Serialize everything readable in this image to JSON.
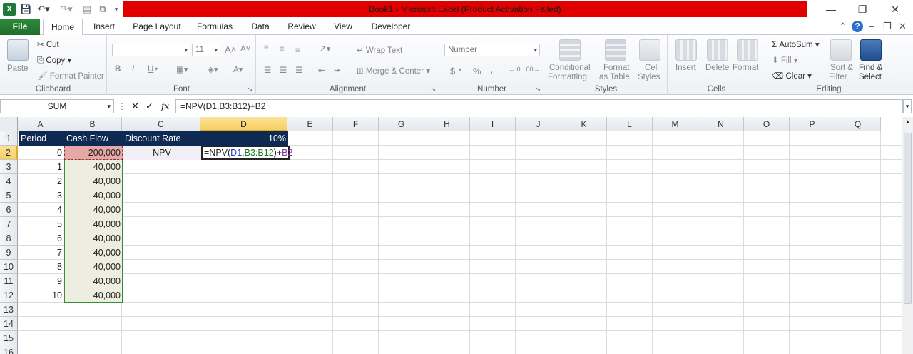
{
  "window": {
    "title": "Book1  -  Microsoft Excel (Product Activation Failed)",
    "controls": {
      "minimize": "—",
      "restore": "❐",
      "close": "✕"
    }
  },
  "ribbon_tabs": [
    "File",
    "Home",
    "Insert",
    "Page Layout",
    "Formulas",
    "Data",
    "Review",
    "View",
    "Developer"
  ],
  "active_tab": "Home",
  "ribbon": {
    "clipboard": {
      "label": "Clipboard",
      "paste": "Paste",
      "cut": "Cut",
      "copy": "Copy",
      "format_painter": "Format Painter"
    },
    "font": {
      "label": "Font",
      "font_name": "",
      "font_size": "11",
      "bold": "B",
      "italic": "I",
      "underline": "U"
    },
    "alignment": {
      "label": "Alignment",
      "wrap_text": "Wrap Text",
      "merge_center": "Merge & Center"
    },
    "number": {
      "label": "Number",
      "format": "Number",
      "currency": "$",
      "percent": "%",
      "comma": ","
    },
    "styles": {
      "label": "Styles",
      "conditional": "Conditional",
      "conditional2": "Formatting",
      "format_table": "Format",
      "format_table2": "as Table",
      "cell_styles": "Cell",
      "cell_styles2": "Styles"
    },
    "cells": {
      "label": "Cells",
      "insert": "Insert",
      "delete": "Delete",
      "format": "Format"
    },
    "editing": {
      "label": "Editing",
      "autosum": "AutoSum",
      "fill": "Fill",
      "clear": "Clear",
      "sort": "Sort &",
      "sort2": "Filter",
      "find": "Find &",
      "find2": "Select"
    }
  },
  "formula_bar": {
    "name_box": "SUM",
    "cancel": "✕",
    "enter": "✓",
    "fx": "fx",
    "formula": "=NPV(D1,B3:B12)+B2"
  },
  "columns": [
    "A",
    "B",
    "C",
    "D",
    "E",
    "F",
    "G",
    "H",
    "I",
    "J",
    "K",
    "L",
    "M",
    "N",
    "O",
    "P",
    "Q"
  ],
  "rows": [
    "1",
    "2",
    "3",
    "4",
    "5",
    "6",
    "7",
    "8",
    "9",
    "10",
    "11",
    "12",
    "13",
    "14",
    "15",
    "16"
  ],
  "cells": {
    "A1": "Period",
    "B1": "Cash Flow",
    "C1": "Discount Rate",
    "D1": "10%",
    "C2": "NPV",
    "edit_formula": {
      "part1": "=NPV(",
      "part2": "D1",
      "part3": ",",
      "part4": "B3:B12",
      "part5": ")+",
      "part6": "B2"
    },
    "periods": [
      "0",
      "1",
      "2",
      "3",
      "4",
      "5",
      "6",
      "7",
      "8",
      "9",
      "10"
    ],
    "cash_flows": [
      "-200,000",
      "40,000",
      "40,000",
      "40,000",
      "40,000",
      "40,000",
      "40,000",
      "40,000",
      "40,000",
      "40,000",
      "40,000"
    ]
  },
  "colors": {
    "header_fill": "#0f2a52",
    "title_bar": "#e00000",
    "file_tab": "#217346",
    "b2_ref": "#e6a7a7",
    "range_ref": "#eeeee0"
  }
}
